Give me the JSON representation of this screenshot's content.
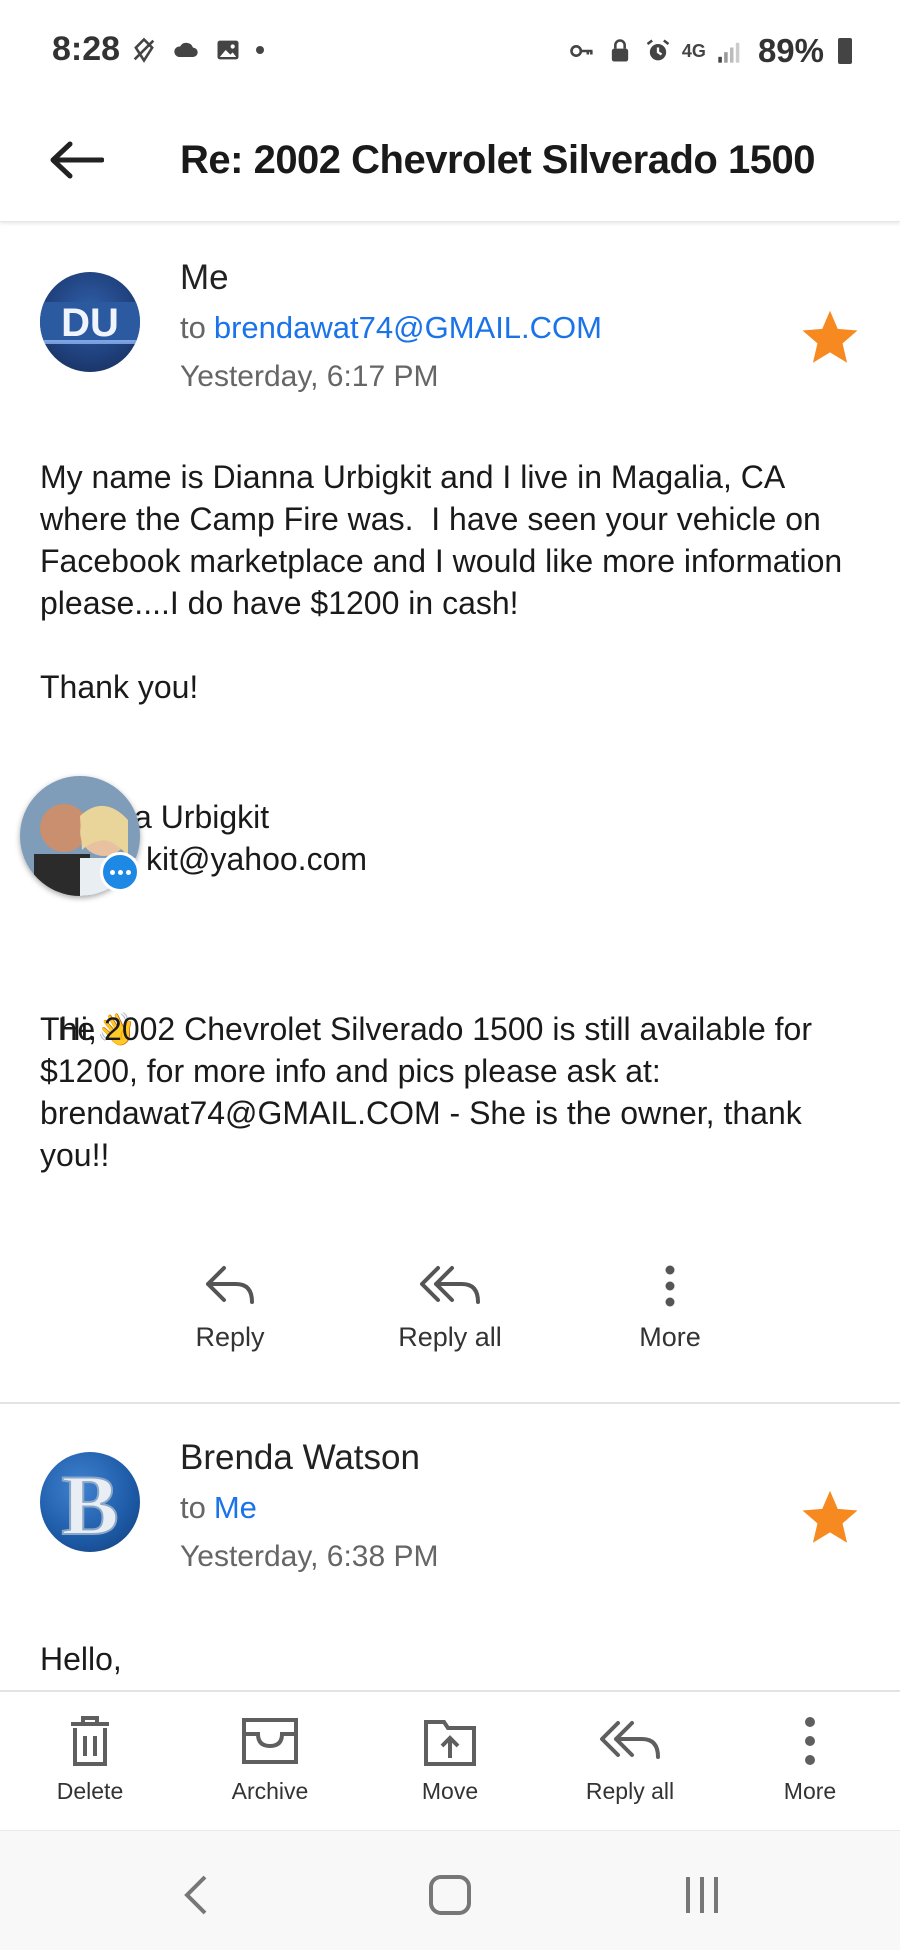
{
  "status_bar": {
    "time": "8:28",
    "battery": "89%",
    "network": "4G"
  },
  "header": {
    "subject": "Re: 2002 Chevrolet Silverado 1500"
  },
  "messages": [
    {
      "sender": "Me",
      "to_label": "to",
      "to": "brendawat74@GMAIL.COM",
      "date": "Yesterday, 6:17 PM",
      "avatar_text": "DU",
      "starred": true,
      "star_color": "#f6891f",
      "body_intro": "My name is Dianna Urbigkit and I live in Magalia, CA\nwhere the Camp Fire was.  I have seen your vehicle on Facebook marketplace and I would like more information please....I do have $1200 in cash!\n\nThank you!",
      "signature_name": "a Urbigkit",
      "signature_email": "kit@yahoo.com",
      "reply_greeting": "Hi,",
      "reply_emoji": "👋",
      "reply_body": "The 2002 Chevrolet Silverado 1500 is still available for $1200, for more info and pics please ask at: brendawat74@GMAIL.COM - She is the owner, thank you!!"
    },
    {
      "sender": "Brenda Watson",
      "to_label": "to",
      "to": "Me",
      "date": "Yesterday, 6:38 PM",
      "avatar_text": "B",
      "starred": true,
      "star_color": "#f6891f",
      "body_intro": "Hello,"
    }
  ],
  "message_actions": {
    "reply": "Reply",
    "reply_all": "Reply all",
    "more": "More"
  },
  "bottom_toolbar": {
    "delete": "Delete",
    "archive": "Archive",
    "move": "Move",
    "reply_all": "Reply all",
    "more": "More"
  },
  "colors": {
    "link": "#1a73e8",
    "star": "#f6891f",
    "avatar_du_bg": "#1f3f7a",
    "avatar_b_bg": "#1d5aa6"
  }
}
